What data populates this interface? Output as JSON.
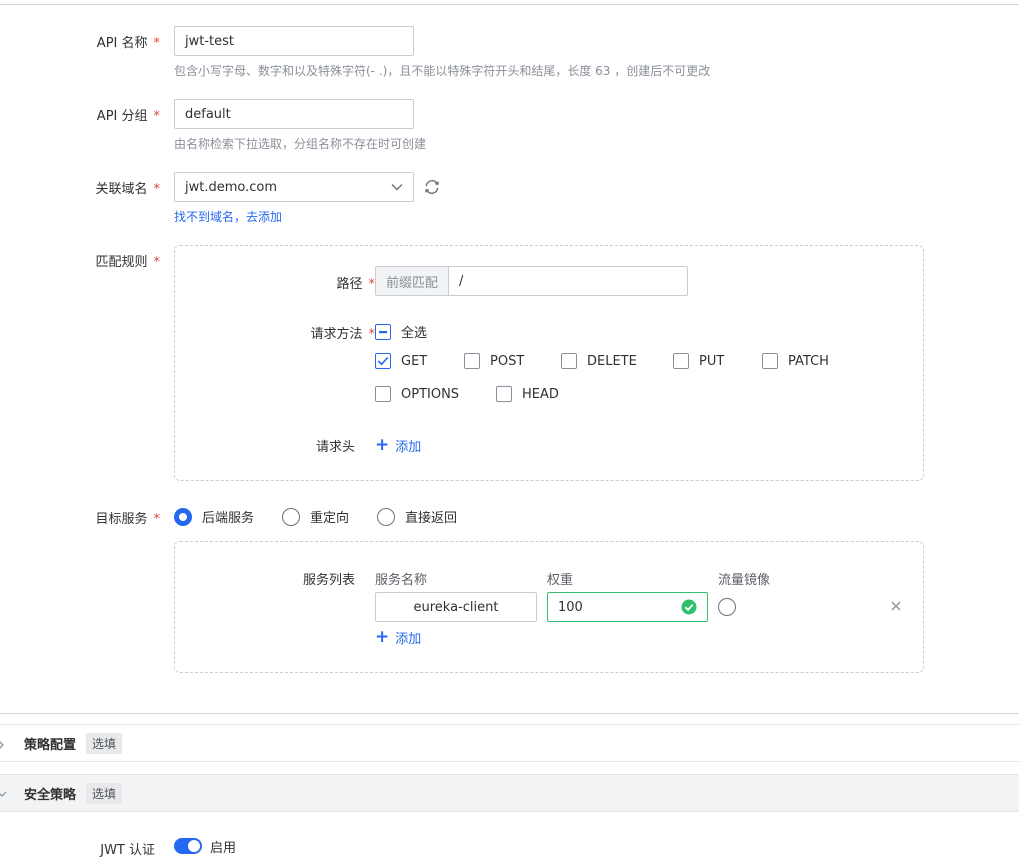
{
  "api_name": {
    "label": "API 名称",
    "value": "jwt-test",
    "hint": "包含小写字母、数字和以及特殊字符(- .)，且不能以特殊字符开头和结尾，长度 63 ，创建后不可更改"
  },
  "api_group": {
    "label": "API 分组",
    "value": "default",
    "hint": "由名称检索下拉选取，分组名称不存在时可创建"
  },
  "domain": {
    "label": "关联域名",
    "value": "jwt.demo.com",
    "link": "找不到域名，去添加"
  },
  "match_rules": {
    "label": "匹配规则",
    "path": {
      "label": "路径",
      "prefix": "前缀匹配",
      "value": "/"
    },
    "methods": {
      "label": "请求方法",
      "select_all": "全选",
      "items": [
        {
          "label": "GET",
          "checked": true
        },
        {
          "label": "POST",
          "checked": false
        },
        {
          "label": "DELETE",
          "checked": false
        },
        {
          "label": "PUT",
          "checked": false
        },
        {
          "label": "PATCH",
          "checked": false
        },
        {
          "label": "OPTIONS",
          "checked": false
        },
        {
          "label": "HEAD",
          "checked": false
        }
      ]
    },
    "headers": {
      "label": "请求头",
      "add": "添加"
    }
  },
  "target": {
    "label": "目标服务",
    "options": [
      {
        "label": "后端服务",
        "checked": true
      },
      {
        "label": "重定向",
        "checked": false
      },
      {
        "label": "直接返回",
        "checked": false
      }
    ],
    "service_list": {
      "label": "服务列表",
      "col_name": "服务名称",
      "col_weight": "权重",
      "col_mirror": "流量镜像",
      "row": {
        "name": "eureka-client",
        "weight": "100"
      },
      "add": "添加"
    }
  },
  "sections": {
    "policy": {
      "title": "策略配置",
      "tag": "选填"
    },
    "security": {
      "title": "安全策略",
      "tag": "选填"
    }
  },
  "jwt": {
    "label": "JWT 认证",
    "toggle_label": "启用",
    "enabled": true
  },
  "colors": {
    "accent": "#2468f2",
    "required": "#e0463b",
    "success": "#30bf6c"
  }
}
